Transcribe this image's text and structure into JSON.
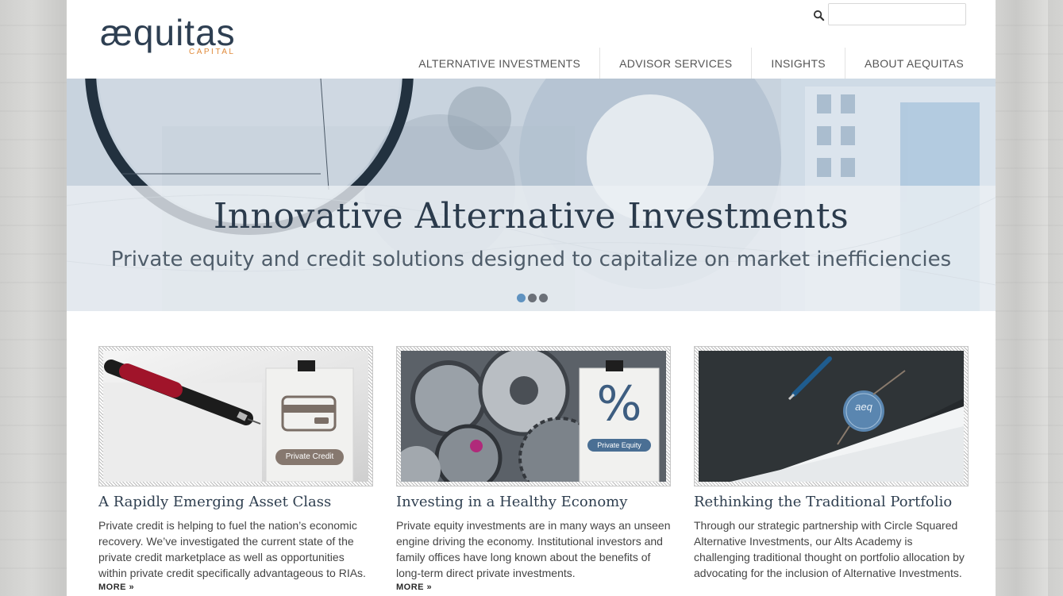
{
  "header": {
    "logo_word": "æquitas",
    "logo_sub": "CAPITAL",
    "search": {
      "placeholder": "",
      "value": ""
    },
    "nav": [
      {
        "label": "ALTERNATIVE INVESTMENTS"
      },
      {
        "label": "ADVISOR SERVICES"
      },
      {
        "label": "INSIGHTS"
      },
      {
        "label": "ABOUT AEQUITAS"
      }
    ]
  },
  "hero": {
    "title": "Innovative Alternative Investments",
    "subtitle": "Private equity and credit solutions designed to capitalize on market inefficiencies",
    "slides": 3,
    "active_slide": 1
  },
  "cards": [
    {
      "image_label": "Private Credit",
      "title": "A Rapidly Emerging Asset Class",
      "text": "Private credit is helping to fuel the nation’s economic recovery. We’ve investigated the current state of the private credit marketplace as well as opportunities within private credit specifically advantageous to RIAs.",
      "more": "MORE »"
    },
    {
      "image_label": "Private Equity",
      "image_symbol": "%",
      "title": "Investing in a Healthy Economy",
      "text": "Private equity investments are in many ways an unseen engine driving the economy. Institutional investors and family offices have long known about the benefits of long-term direct private investments.",
      "more": "MORE »"
    },
    {
      "image_seal": "aeq",
      "title": "Rethinking the Traditional Portfolio",
      "text": "Through our strategic partnership with Circle Squared Alternative Investments, our Alts Academy is challenging traditional thought on portfolio allocation by advocating for the inclusion of Alternative Investments.",
      "more": ""
    }
  ],
  "colors": {
    "accent": "#e08a3a",
    "brand_dark": "#2e3f52",
    "dot_active": "#5f92c0"
  }
}
